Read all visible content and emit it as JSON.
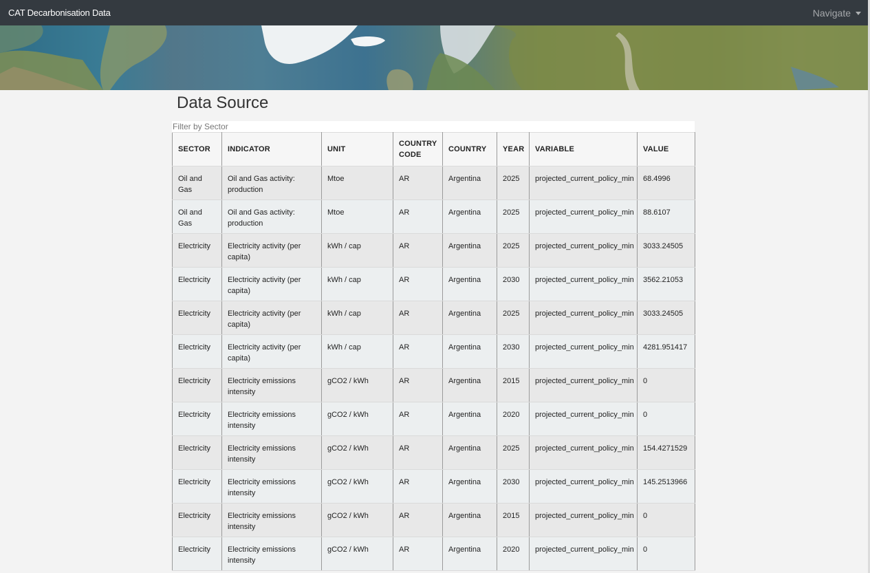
{
  "navbar": {
    "brand": "CAT Decarbonisation Data",
    "menu_label": "Navigate"
  },
  "page": {
    "title": "Data Source"
  },
  "filter": {
    "placeholder": "Filter by Sector"
  },
  "table": {
    "columns": [
      "SECTOR",
      "INDICATOR",
      "UNIT",
      "COUNTRY CODE",
      "COUNTRY",
      "YEAR",
      "VARIABLE",
      "VALUE"
    ],
    "rows": [
      [
        "Oil and Gas",
        "Oil and Gas activity: production",
        "Mtoe",
        "AR",
        "Argentina",
        "2025",
        "projected_current_policy_min",
        "68.4996"
      ],
      [
        "Oil and Gas",
        "Oil and Gas activity: production",
        "Mtoe",
        "AR",
        "Argentina",
        "2025",
        "projected_current_policy_min",
        "88.6107"
      ],
      [
        "Electricity",
        "Electricity activity (per capita)",
        "kWh / cap",
        "AR",
        "Argentina",
        "2025",
        "projected_current_policy_min",
        "3033.24505"
      ],
      [
        "Electricity",
        "Electricity activity (per capita)",
        "kWh / cap",
        "AR",
        "Argentina",
        "2030",
        "projected_current_policy_min",
        "3562.21053"
      ],
      [
        "Electricity",
        "Electricity activity (per capita)",
        "kWh / cap",
        "AR",
        "Argentina",
        "2025",
        "projected_current_policy_min",
        "3033.24505"
      ],
      [
        "Electricity",
        "Electricity activity (per capita)",
        "kWh / cap",
        "AR",
        "Argentina",
        "2030",
        "projected_current_policy_min",
        "4281.951417"
      ],
      [
        "Electricity",
        "Electricity emissions intensity",
        "gCO2 / kWh",
        "AR",
        "Argentina",
        "2015",
        "projected_current_policy_min",
        "0"
      ],
      [
        "Electricity",
        "Electricity emissions intensity",
        "gCO2 / kWh",
        "AR",
        "Argentina",
        "2020",
        "projected_current_policy_min",
        "0"
      ],
      [
        "Electricity",
        "Electricity emissions intensity",
        "gCO2 / kWh",
        "AR",
        "Argentina",
        "2025",
        "projected_current_policy_min",
        "154.4271529"
      ],
      [
        "Electricity",
        "Electricity emissions intensity",
        "gCO2 / kWh",
        "AR",
        "Argentina",
        "2030",
        "projected_current_policy_min",
        "145.2513966"
      ],
      [
        "Electricity",
        "Electricity emissions intensity",
        "gCO2 / kWh",
        "AR",
        "Argentina",
        "2015",
        "projected_current_policy_min",
        "0"
      ],
      [
        "Electricity",
        "Electricity emissions intensity",
        "gCO2 / kWh",
        "AR",
        "Argentina",
        "2020",
        "projected_current_policy_min",
        "0"
      ]
    ]
  }
}
